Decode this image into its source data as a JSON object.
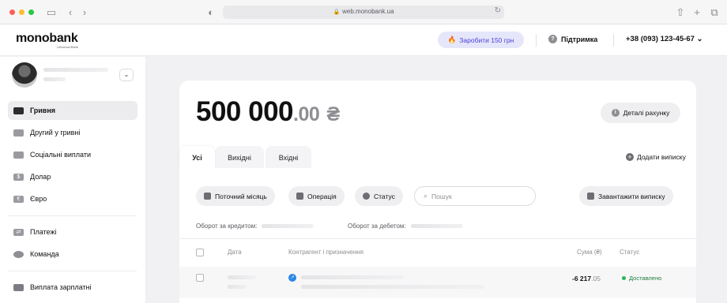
{
  "browser": {
    "url": "web.monobank.ua"
  },
  "header": {
    "logo": "monobank",
    "logo_sub": "Universal Bank",
    "earn_button": "Заробити 150 грн",
    "support": "Підтримка",
    "phone": "+38 (093) 123-45-67"
  },
  "sidebar": {
    "items": [
      {
        "label": "Гривня",
        "icon": "card-icon",
        "active": true
      },
      {
        "label": "Другий у гривні",
        "icon": "card-icon"
      },
      {
        "label": "Соціальні виплати",
        "icon": "card-icon"
      },
      {
        "label": "Долар",
        "icon": "dollar-icon"
      },
      {
        "label": "Євро",
        "icon": "euro-icon"
      },
      {
        "label": "Платежі",
        "icon": "transfer-icon"
      },
      {
        "label": "Команда",
        "icon": "team-icon"
      },
      {
        "label": "Виплата зарплатні",
        "icon": "salary-icon"
      }
    ]
  },
  "account": {
    "balance_int": "500 000",
    "balance_dec": ".00",
    "currency": "₴",
    "details_button": "Деталі рахунку"
  },
  "tabs": [
    {
      "label": "Усі",
      "active": true
    },
    {
      "label": "Вихідні"
    },
    {
      "label": "Вхідні"
    }
  ],
  "add_statement": "Додати виписку",
  "filters": {
    "period": "Поточний місяць",
    "operation": "Операція",
    "status": "Статус",
    "search_placeholder": "Пошук",
    "download": "Завантажити виписку"
  },
  "turnover": {
    "credit": "Оборот за кредитом:",
    "debit": "Оборот за дебетом:"
  },
  "table": {
    "columns": {
      "date": "Дата",
      "counterparty": "Контрагент і призначення",
      "amount": "Сума (₴)",
      "status": "Статус"
    },
    "rows": [
      {
        "amount_int": "-6 217",
        "amount_dec": ".05",
        "status": "Доставлено"
      }
    ]
  },
  "colors": {
    "accent": "#4b3fd6",
    "status_ok": "#2bb457"
  }
}
